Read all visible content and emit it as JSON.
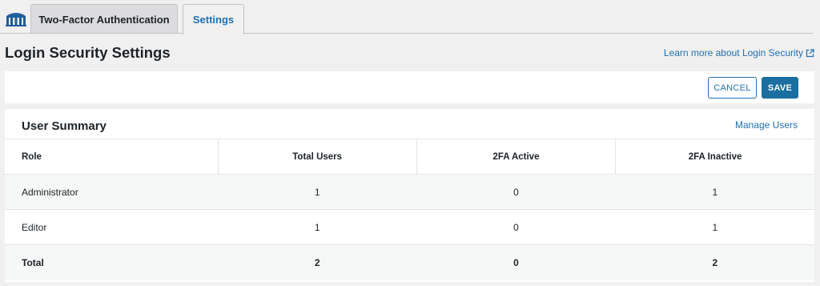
{
  "tabs": [
    {
      "label": "Two-Factor Authentication",
      "active": false
    },
    {
      "label": "Settings",
      "active": true
    }
  ],
  "header": {
    "title": "Login Security Settings",
    "learn_more": "Learn more about Login Security"
  },
  "actions": {
    "cancel_label": "CANCEL",
    "save_label": "SAVE"
  },
  "summary": {
    "title": "User Summary",
    "manage_link": "Manage Users",
    "columns": [
      "Role",
      "Total Users",
      "2FA Active",
      "2FA Inactive"
    ],
    "rows": [
      {
        "role": "Administrator",
        "total": "1",
        "active": "0",
        "inactive": "1"
      },
      {
        "role": "Editor",
        "total": "1",
        "active": "0",
        "inactive": "1"
      }
    ],
    "totals": {
      "role": "Total",
      "total": "2",
      "active": "0",
      "inactive": "2"
    }
  },
  "colors": {
    "accent": "#2271b1",
    "save_bg": "#1a6fa0",
    "page_bg": "#f0f0f1"
  },
  "icons": {
    "logo": "wordfence-logo-icon",
    "external": "external-link-icon"
  }
}
